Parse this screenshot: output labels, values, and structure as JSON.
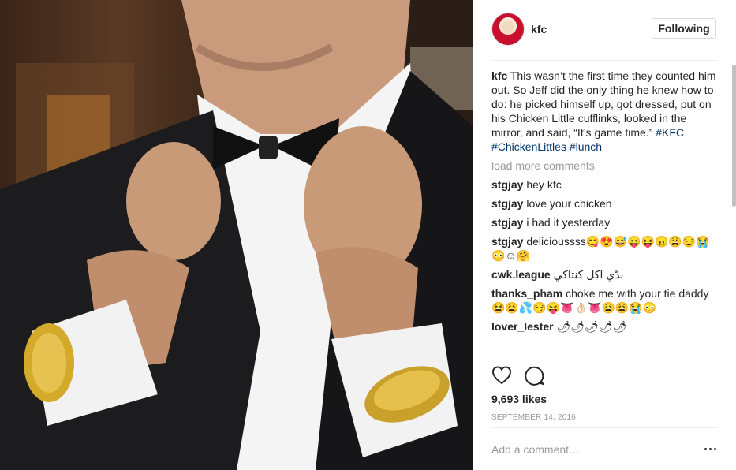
{
  "post": {
    "username": "kfc",
    "follow_label": "Following",
    "caption_user": "kfc",
    "caption_text": "This wasn’t the first time they counted him out. So Jeff did the only thing he knew how to do: he picked himself up, got dressed, put on his Chicken Little cufflinks, looked in the mirror, and said, “It’s game time.”",
    "hashtags": "#KFC #ChickenLittles #lunch",
    "load_more": "load more comments",
    "comments": [
      {
        "user": "stgjay",
        "text": "hey kfc"
      },
      {
        "user": "stgjay",
        "text": "love your chicken"
      },
      {
        "user": "stgjay",
        "text": "i had it yesterday"
      },
      {
        "user": "stgjay",
        "text": "delicioussss😋😍😅😛😝😠😩😏😭😳☺🤗"
      },
      {
        "user": "cwk.league",
        "text": "بدّي اكل كنتاكي"
      },
      {
        "user": "thanks_pham",
        "text": "choke me with your tie daddy😫😩💦😏😝👅👌🏻👅😩😩😭😳"
      },
      {
        "user": "lover_lester",
        "text": "🌶🌶🌶🌶🌶"
      }
    ],
    "likes": "9,693 likes",
    "date": "SEPTEMBER 14, 2016",
    "add_comment_placeholder": "Add a comment…"
  },
  "icons": {
    "like": "heart-icon",
    "comment": "comment-bubble-icon",
    "more": "more-options-icon"
  },
  "colors": {
    "hashtag": "#003569",
    "muted": "#999999",
    "text": "#262626"
  }
}
